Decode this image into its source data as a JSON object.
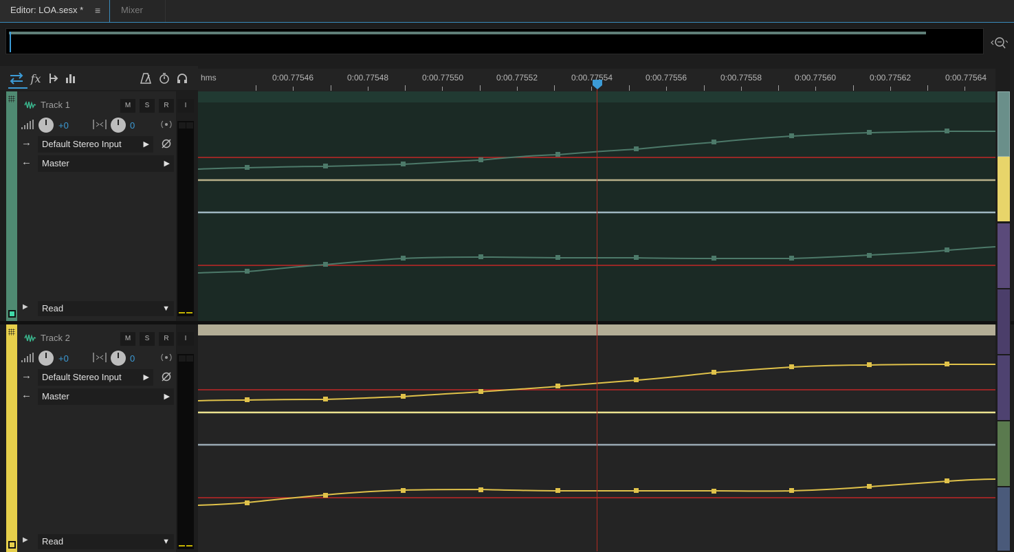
{
  "tabs": {
    "editor": "Editor: LOA.sesx *",
    "editor_menu": "≡",
    "mixer": "Mixer"
  },
  "ruler": {
    "unit": "hms",
    "ticks": [
      "0:00.77546",
      "0:00.77548",
      "0:00.77550",
      "0:00.77552",
      "0:00.77554",
      "0:00.77556",
      "0:00.77558",
      "0:00.77560",
      "0:00.77562",
      "0:00.77564"
    ]
  },
  "toolbar": {
    "tools": [
      "move-tool-icon",
      "fx-icon",
      "send-icon",
      "eq-icon"
    ],
    "right_tools": [
      "metronome-icon",
      "timer-icon",
      "headphones-icon"
    ]
  },
  "tracks": [
    {
      "name": "Track 1",
      "color": "#4f8a72",
      "mute": "M",
      "solo": "S",
      "record": "R",
      "input_monitor": "I",
      "volume": "+0",
      "pan": "0",
      "input": "Default Stereo Input",
      "output": "Master",
      "automation_mode": "Read"
    },
    {
      "name": "Track 2",
      "color": "#e6cf4b",
      "mute": "M",
      "solo": "S",
      "record": "R",
      "input_monitor": "I",
      "volume": "+0",
      "pan": "0",
      "input": "Default Stereo Input",
      "output": "Master",
      "automation_mode": "Read"
    }
  ],
  "colors": {
    "accent": "#3c9bd6",
    "playhead": "#b22a22",
    "track1_wave": "#4d7a6a",
    "track2_wave": "#e0c24a"
  }
}
